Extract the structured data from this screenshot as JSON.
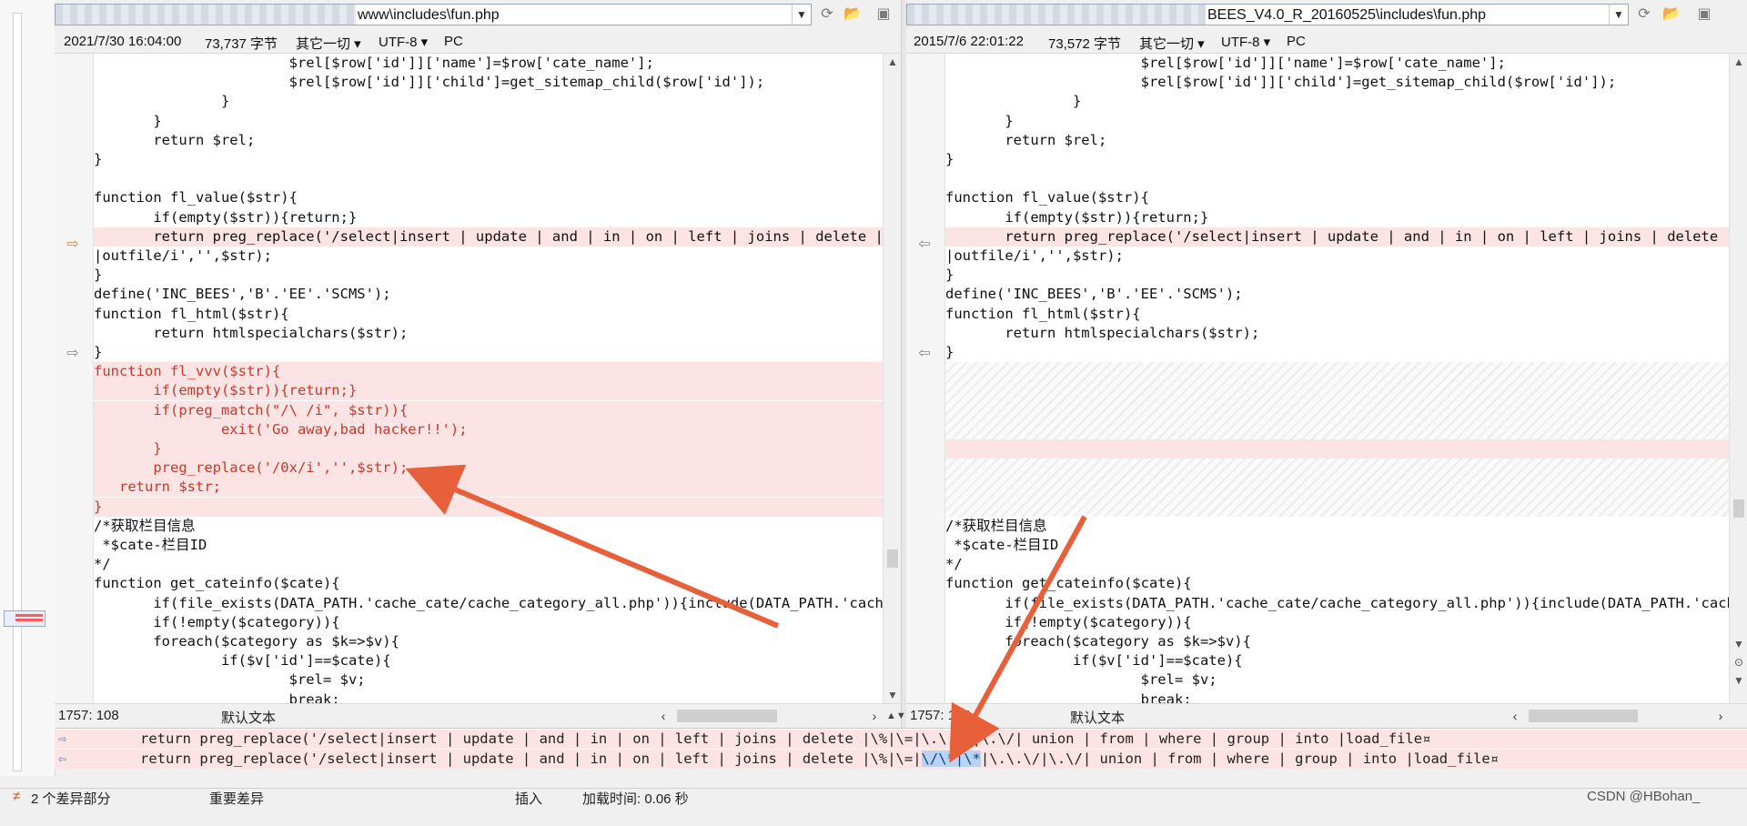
{
  "left": {
    "path": "www\\includes\\fun.php",
    "date": "2021/7/30 16:04:00",
    "size": "73,737 字节",
    "type": "其它一切",
    "encoding": "UTF-8",
    "lineend": "PC",
    "cursor": "1757: 108",
    "mode": "默认文本",
    "lines": [
      "                       $rel[$row['id']]['name']=$row['cate_name'];",
      "                       $rel[$row['id']]['child']=get_sitemap_child($row['id']);",
      "               }",
      "       }",
      "       return $rel;",
      "}",
      "",
      "function fl_value($str){",
      "       if(empty($str)){return;}",
      "       return preg_replace('/select|insert | update | and | in | on | left | joins | delete |\\%",
      "|outfile/i','',$str);",
      "}",
      "define('INC_BEES','B'.'EE'.'SCMS');",
      "function fl_html($str){",
      "       return htmlspecialchars($str);",
      "}",
      "function fl_vvv($str){",
      "       if(empty($str)){return;}",
      "       if(preg_match(\"/\\ /i\", $str)){",
      "               exit('Go away,bad hacker!!');",
      "       }",
      "       preg_replace('/0x/i','',$str);",
      "   return $str;",
      "}",
      "/*获取栏目信息",
      " *$cate-栏目ID",
      "*/",
      "function get_cateinfo($cate){",
      "       if(file_exists(DATA_PATH.'cache_cate/cache_category_all.php')){include(DATA_PATH.'cache_",
      "       if(!empty($category)){",
      "       foreach($category as $k=>$v){",
      "               if($v['id']==$cate){",
      "                       $rel= $v;",
      "                       break;"
    ]
  },
  "right": {
    "path": "BEES_V4.0_R_20160525\\includes\\fun.php",
    "date": "2015/7/6 22:01:22",
    "size": "73,572 字节",
    "type": "其它一切",
    "encoding": "UTF-8",
    "lineend": "PC",
    "cursor": "1757: 108",
    "mode": "默认文本",
    "lines": [
      "                       $rel[$row['id']]['name']=$row['cate_name'];",
      "                       $rel[$row['id']]['child']=get_sitemap_child($row['id']);",
      "               }",
      "       }",
      "       return $rel;",
      "}",
      "",
      "function fl_value($str){",
      "       if(empty($str)){return;}",
      "       return preg_replace('/select|insert | update | and | in | on | left | joins | delete |\\%",
      "|outfile/i','',$str);",
      "}",
      "define('INC_BEES','B'.'EE'.'SCMS');",
      "function fl_html($str){",
      "       return htmlspecialchars($str);",
      "}",
      "/*获取栏目信息",
      " *$cate-栏目ID",
      "*/",
      "function get_cateinfo($cate){",
      "       if(file_exists(DATA_PATH.'cache_cate/cache_category_all.php')){include(DATA_PATH.'cache_",
      "       if(!empty($category)){",
      "       foreach($category as $k=>$v){",
      "               if($v['id']==$cate){",
      "                       $rel= $v;",
      "                       break;"
    ]
  },
  "compare": {
    "line1": "return preg_replace('/select|insert | update | and | in | on | left | joins | delete |\\%|\\=|\\.\\.\\/|\\.\\/| union | from | where | group | into |load_file¤",
    "line2_pre": "return preg_replace('/select|insert | update | and | in | on | left | joins | delete |\\%|\\=|",
    "line2_hl": "\\/\\*|\\*",
    "line2_post": "|\\.\\.\\/|\\.\\/| union | from | where | group | into |load_file¤"
  },
  "status": {
    "diff_count": "2 个差异部分",
    "diff_type": "重要差异",
    "insert": "插入",
    "load_time": "加载时间: 0.06 秒",
    "watermark": "CSDN @HBohan_"
  },
  "colors": {
    "diff_bg": "#fde4e4",
    "diff_text": "#c53a2a",
    "arrow": "#e8603a",
    "highlight": "#b9d4f3"
  }
}
